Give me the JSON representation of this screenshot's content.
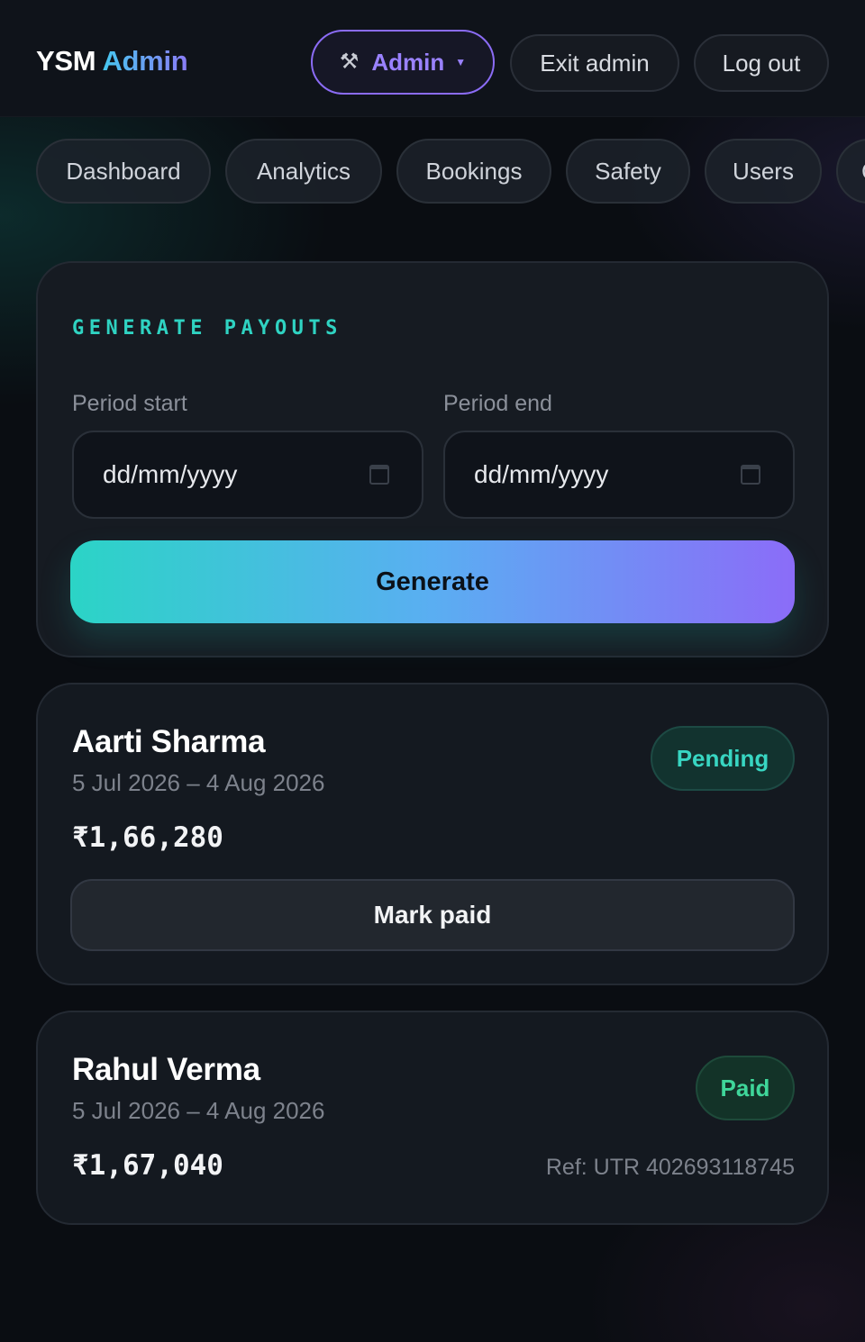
{
  "header": {
    "brand_primary": "YSM",
    "brand_secondary": "Admin",
    "admin_menu_label": "Admin",
    "exit_admin_label": "Exit admin",
    "logout_label": "Log out"
  },
  "nav": {
    "tabs": [
      {
        "label": "Dashboard"
      },
      {
        "label": "Analytics"
      },
      {
        "label": "Bookings"
      },
      {
        "label": "Safety"
      },
      {
        "label": "Users"
      },
      {
        "label": "C"
      }
    ]
  },
  "generate": {
    "title": "GENERATE PAYOUTS",
    "period_start_label": "Period start",
    "period_start_placeholder": "dd/mm/yyyy",
    "period_end_label": "Period end",
    "period_end_placeholder": "dd/mm/yyyy",
    "generate_label": "Generate"
  },
  "payouts": [
    {
      "name": "Aarti Sharma",
      "period": "5 Jul 2026 – 4 Aug 2026",
      "amount": "₹1,66,280",
      "status": "Pending",
      "action_label": "Mark paid"
    },
    {
      "name": "Rahul Verma",
      "period": "5 Jul 2026 – 4 Aug 2026",
      "amount": "₹1,67,040",
      "status": "Paid",
      "reference": "Ref: UTR 402693118745"
    }
  ],
  "colors": {
    "accent_teal": "#2fd3c2",
    "accent_violet": "#8b6cf5",
    "paid_green": "#3fd69a",
    "background": "#0a0d12"
  },
  "icons": {
    "admin_menu": "tools-icon",
    "dropdown": "caret-down-icon",
    "date_picker": "calendar-icon"
  }
}
